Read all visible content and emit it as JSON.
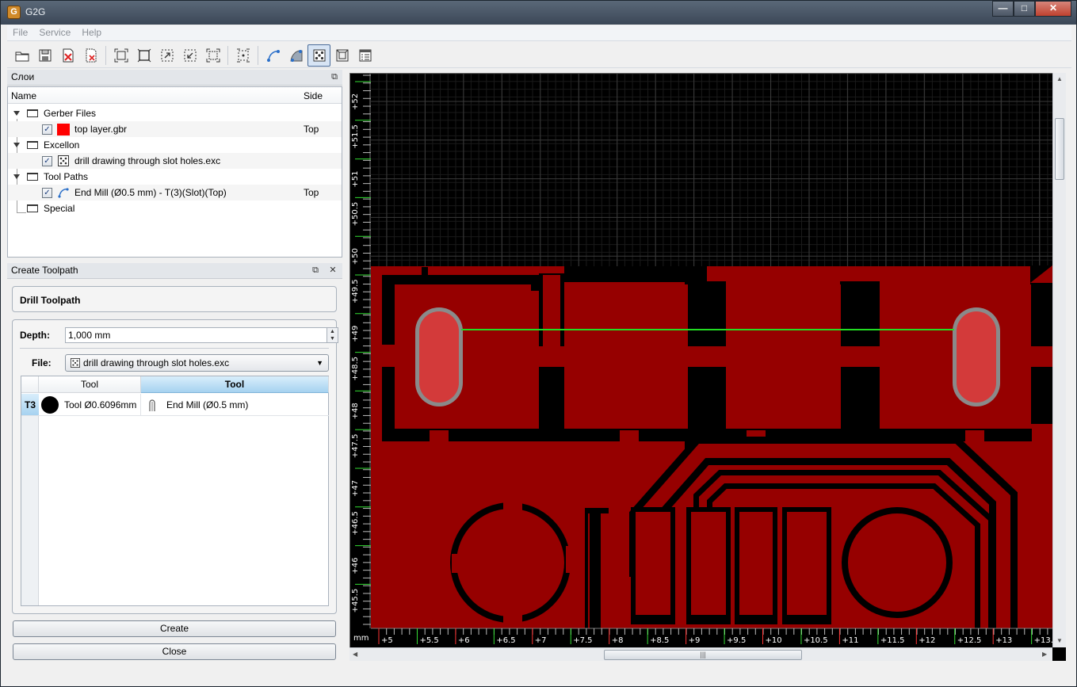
{
  "window": {
    "title": "G2G",
    "app_icon": "G",
    "buttons": [
      "minimize",
      "maximize",
      "close"
    ]
  },
  "menu": [
    "File",
    "Service",
    "Help"
  ],
  "toolbar": [
    {
      "icon": "open-folder-icon"
    },
    {
      "icon": "save-icon"
    },
    {
      "icon": "close-file-icon"
    },
    {
      "icon": "close-all-icon"
    },
    {
      "sep": true
    },
    {
      "icon": "zoom-fit-icon"
    },
    {
      "icon": "zoom-board-icon"
    },
    {
      "icon": "zoom-selection-icon"
    },
    {
      "icon": "zoom-out-icon"
    },
    {
      "icon": "zoom-to-fit-all-icon"
    },
    {
      "sep": true
    },
    {
      "icon": "snap-icon"
    },
    {
      "sep": true
    },
    {
      "icon": "profile-path-icon"
    },
    {
      "icon": "pocket-path-icon"
    },
    {
      "icon": "drill-icon",
      "active": true
    },
    {
      "icon": "thermal-icon"
    },
    {
      "icon": "settings-list-icon"
    }
  ],
  "layers_panel": {
    "title": "Слои",
    "col_name": "Name",
    "col_side": "Side",
    "groups": [
      {
        "label": "Gerber Files",
        "child": {
          "label": "top layer.gbr",
          "side": "Top",
          "color": "#ff0000"
        }
      },
      {
        "label": "Excellon",
        "child": {
          "label": "drill drawing through slot holes.exc",
          "side": ""
        }
      },
      {
        "label": "Tool Paths",
        "child": {
          "label": "End Mill (Ø0.5 mm) - T(3)(Slot)(Top)",
          "side": "Top"
        }
      },
      {
        "label": "Special"
      }
    ]
  },
  "toolpath_panel": {
    "title": "Create Toolpath",
    "heading": "Drill Toolpath",
    "depth_label": "Depth:",
    "depth_value": "1,000 mm",
    "file_label": "File:",
    "file_value": "drill drawing through slot holes.exc",
    "table": {
      "headers": [
        "Tool",
        "Tool"
      ],
      "rows": [
        {
          "id": "T3",
          "tool": "Tool Ø0.6096mm",
          "mill": "End Mill (Ø0.5 mm)"
        }
      ]
    },
    "create_label": "Create",
    "close_label": "Close"
  },
  "view": {
    "unit": "mm",
    "x_ticks": [
      "+5",
      "+5.5",
      "+6",
      "+6.5",
      "+7",
      "+7.5",
      "+8",
      "+8.5",
      "+9",
      "+9.5",
      "+10",
      "+10.5",
      "+11",
      "+11.5",
      "+12",
      "+12.5",
      "+13",
      "+13."
    ],
    "y_ticks": [
      "+52",
      "+51.5",
      "+51",
      "+50.5",
      "+50",
      "+49.5",
      "+49",
      "+48.5",
      "+48",
      "+47.5",
      "+47",
      "+46.5",
      "+46",
      "+45.5"
    ],
    "copper_color": "#960000",
    "drill_color": "#d33a3a",
    "path_color": "#22dd22"
  }
}
